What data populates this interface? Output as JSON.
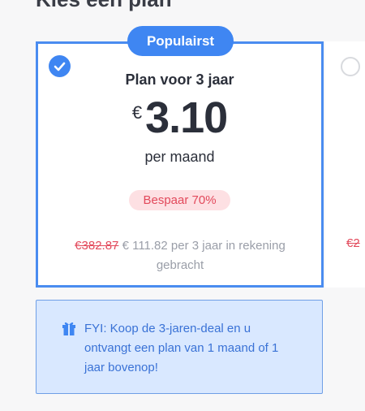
{
  "page": {
    "heading": "Kies een plan"
  },
  "plan": {
    "badge": "Populairst",
    "title": "Plan voor 3 jaar",
    "currency": "€",
    "amount": "3.10",
    "period": "per maand",
    "savings": "Bespaar 70%",
    "old_price": "€382.87",
    "billing_rest": "€ 111.82 per 3 jaar in rekening gebracht",
    "selected": true
  },
  "second_plan": {
    "old_price_partial": "€2"
  },
  "fyi": {
    "text": "FYI: Koop de 3-jaren-deal en u ontvangt een plan van 1 maand of 1 jaar bovenop!"
  },
  "colors": {
    "accent": "#3f86f2",
    "savings_text": "#e2495b",
    "savings_bg": "#fde0e3",
    "info_bg": "#d9e8ff",
    "info_text": "#3a72d6"
  },
  "icons": {
    "check": "check-icon",
    "gift": "gift-icon",
    "radio": "radio-unselected"
  }
}
